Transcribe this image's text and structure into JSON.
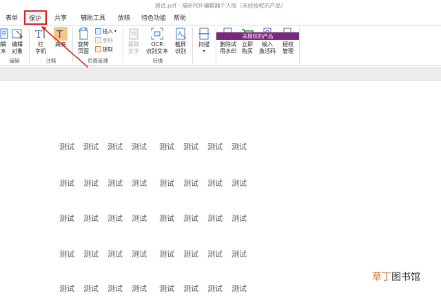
{
  "window": {
    "title": "测试.pdf - 福昕PDF编辑器个人版（未经授权的产品）"
  },
  "tabs": [
    {
      "label": "表单"
    },
    {
      "label": "保护"
    },
    {
      "label": "共享"
    },
    {
      "label": "辅助工具"
    },
    {
      "label": "放映"
    },
    {
      "label": "特色功能"
    },
    {
      "label": "帮助"
    }
  ],
  "ribbon": {
    "edit_group": {
      "label": "编辑",
      "edit_text": "编辑\n文本",
      "edit_object": "编辑\n对象"
    },
    "annotation_group": {
      "label": "注释",
      "typewriter": "打\n字机",
      "highlight": "高亮"
    },
    "page_group": {
      "label": "页面管理",
      "rotate": "旋转\n页面",
      "insert": "插入",
      "delete": "删除",
      "extract": "提取"
    },
    "convert_group": {
      "label": "转换",
      "extract_text": "提取\n文字",
      "ocr": "OCR\n识别文本",
      "screenshot": "截屏\n识别"
    },
    "scan_group": {
      "scan": "扫描"
    },
    "unlicensed_group": {
      "label": "未授权的产品",
      "remove_watermark": "删除试\n用水印",
      "buy_now": "立即\n购买",
      "enter_code": "输入\n激活码",
      "license_manage": "授权\n管理"
    }
  },
  "document": {
    "rows": [
      [
        "测试",
        "测试",
        "测试",
        "测试",
        "测试",
        "测试",
        "测试",
        "测试"
      ],
      [
        "测试",
        "测试",
        "测试",
        "测试",
        "测试",
        "测试",
        "测试",
        "测试"
      ],
      [
        "测试",
        "测试",
        "测试",
        "测试",
        "测试",
        "测试",
        "测试",
        "测试"
      ],
      [
        "测试",
        "测试",
        "测试",
        "测试",
        "测试",
        "测试",
        "测试",
        "测试"
      ],
      [
        "测试",
        "测试",
        "测试",
        "测试",
        "测试",
        "测试",
        "测试",
        "测试"
      ]
    ]
  },
  "watermark": {
    "part1": "草丁",
    "part2": "图书馆"
  },
  "colors": {
    "highlight_box": "#e02020",
    "unlicensed_bar": "#7a2a7a",
    "watermark_accent": "#d06a2a"
  }
}
